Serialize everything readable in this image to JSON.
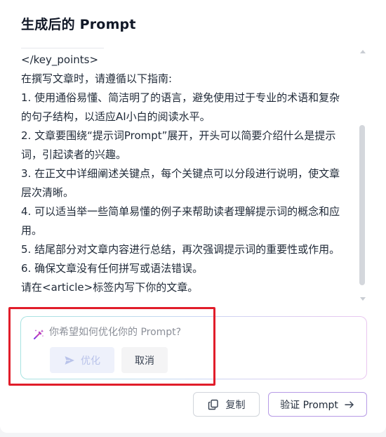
{
  "panel": {
    "title": "生成后的 Prompt"
  },
  "prompt": {
    "lines": [
      "</key_points>",
      "在撰写文章时，请遵循以下指南:",
      "1. 使用通俗易懂、简洁明了的语言，避免使用过于专业的术语和复杂",
      "的句子结构，以适应AI小白的阅读水平。",
      "2. 文章要围绕“提示词Prompt”展开，开头可以简要介绍什么是提示",
      "词，引起读者的兴趣。",
      "3. 在正文中详细阐述关键点，每个关键点可以分段进行说明，使文章",
      "层次清晰。",
      "4. 可以适当举一些简单易懂的例子来帮助读者理解提示词的概念和应",
      "用。",
      "5. 结尾部分对文章内容进行总结，再次强调提示词的重要性或作用。",
      "6. 确保文章没有任何拼写或语法错误。",
      "请在<article>标签内写下你的文章。"
    ]
  },
  "refine": {
    "placeholder": "你希望如何优化你的 Prompt?",
    "value": "",
    "optimize_label": "优化",
    "cancel_label": "取消",
    "icon": "magic-wand-icon"
  },
  "actions": {
    "copy_label": "复制",
    "verify_label": "验证 Prompt"
  },
  "colors": {
    "highlight": "#e11d2a",
    "accent_purple": "#b79be6",
    "optimize_disabled_text": "#b9c3ea",
    "wand_gradient_start": "#7c3aed",
    "wand_gradient_end": "#ec4899"
  }
}
